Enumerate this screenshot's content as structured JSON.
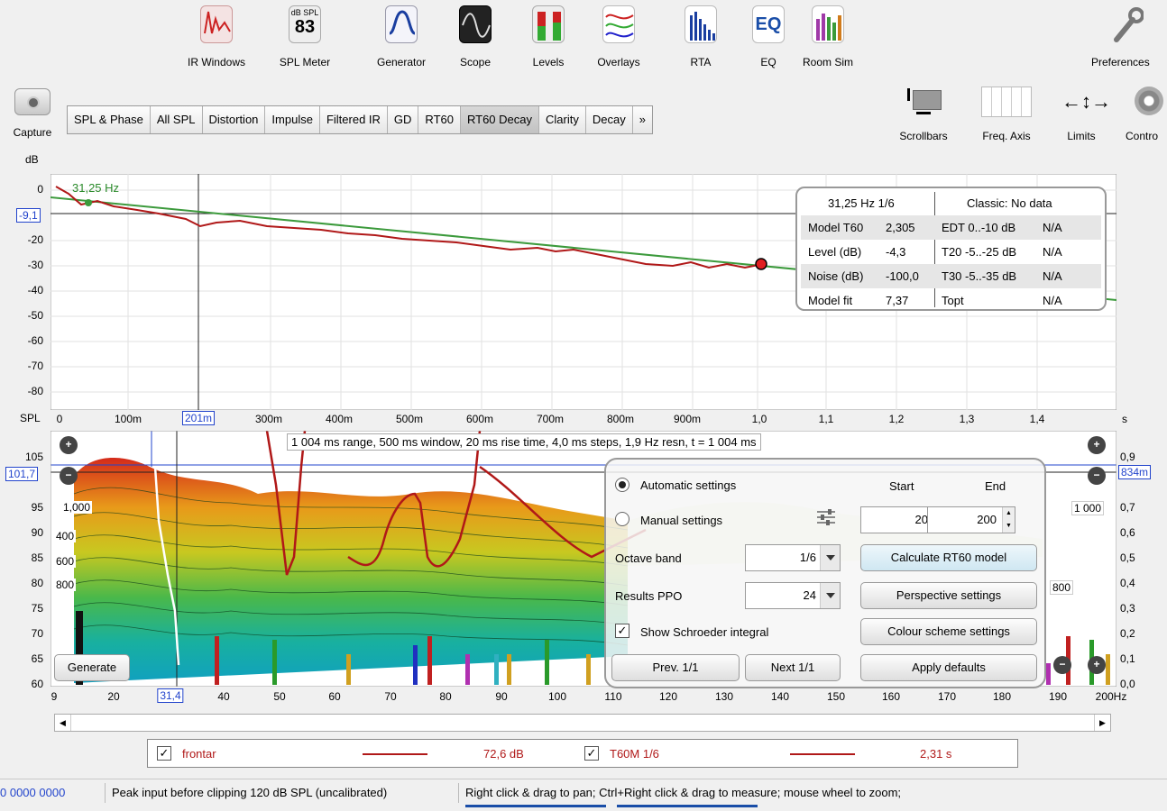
{
  "toolbar": {
    "items": [
      {
        "label": "IR Windows",
        "icon": "ir-windows-icon"
      },
      {
        "label": "SPL Meter",
        "icon": "spl-meter-icon",
        "meter_top": "dB SPL",
        "meter_value": "83"
      },
      {
        "label": "Generator",
        "icon": "generator-icon"
      },
      {
        "label": "Scope",
        "icon": "scope-icon"
      },
      {
        "label": "Levels",
        "icon": "levels-icon"
      },
      {
        "label": "Overlays",
        "icon": "overlays-icon"
      },
      {
        "label": "RTA",
        "icon": "rta-icon"
      },
      {
        "label": "EQ",
        "icon": "eq-icon"
      },
      {
        "label": "Room Sim",
        "icon": "room-sim-icon"
      }
    ],
    "preferences": "Preferences"
  },
  "capture": "Capture",
  "tabs": [
    "SPL & Phase",
    "All SPL",
    "Distortion",
    "Impulse",
    "Filtered IR",
    "GD",
    "RT60",
    "RT60 Decay",
    "Clarity",
    "Decay",
    "»"
  ],
  "active_tab": "RT60 Decay",
  "right_tools": [
    "Scrollbars",
    "Freq. Axis",
    "Limits",
    "Contro"
  ],
  "top_graph": {
    "unit": "dB",
    "y_ticks": [
      "0",
      "-20",
      "-30",
      "-40",
      "-50",
      "-60",
      "-70",
      "-80"
    ],
    "cursor_value": "-9,1",
    "marker_label": "31,25 Hz",
    "x_unit": "s",
    "x_ticks": [
      "0",
      "100m",
      "300m",
      "400m",
      "500m",
      "600m",
      "700m",
      "800m",
      "900m",
      "1,0",
      "1,1",
      "1,2",
      "1,3",
      "1,4"
    ],
    "x_cursor": "201m",
    "info": {
      "title_left": "31,25 Hz 1/6",
      "title_right": "Classic: No data",
      "rows": [
        {
          "k": "Model T60",
          "v": "2,305",
          "k2": "EDT  0..-10 dB",
          "v2": "N/A"
        },
        {
          "k": "Level (dB)",
          "v": "-4,3",
          "k2": "T20 -5..-25 dB",
          "v2": "N/A"
        },
        {
          "k": "Noise (dB)",
          "v": "-100,0",
          "k2": "T30 -5..-35 dB",
          "v2": "N/A"
        },
        {
          "k": "Model fit",
          "v": "7,37",
          "k2": "Topt",
          "v2": "N/A"
        }
      ]
    }
  },
  "bottom_graph": {
    "unit": "SPL",
    "y_ticks": [
      "105",
      "95",
      "90",
      "85",
      "80",
      "75",
      "70",
      "65",
      "60"
    ],
    "cursor_value": "101,7",
    "right_cursor": "834m",
    "right_ticks": [
      "0,9",
      "0,7",
      "0,6",
      "0,5",
      "0,4",
      "0,3",
      "0,2",
      "0,1",
      "0,0"
    ],
    "depth_labels": [
      "1,000",
      "400",
      "600",
      "800"
    ],
    "right_depth_labels": [
      "1 000",
      "800"
    ],
    "info_line": "1 004 ms range, 500 ms window, 20 ms rise time, 4,0 ms steps,  1,9 Hz resn, t = 1 004 ms",
    "x_ticks": [
      "9",
      "20",
      "40",
      "50",
      "60",
      "70",
      "80",
      "90",
      "100",
      "110",
      "120",
      "130",
      "140",
      "150",
      "160",
      "170",
      "180",
      "190",
      "200Hz"
    ],
    "x_cursor": "31,4",
    "generate": "Generate"
  },
  "panel": {
    "auto": "Automatic settings",
    "manual": "Manual settings",
    "start_label": "Start",
    "end_label": "End",
    "start_value": "20",
    "end_value": "200",
    "octave_label": "Octave band",
    "octave_value": "1/6",
    "ppo_label": "Results PPO",
    "ppo_value": "24",
    "schroeder": "Show Schroeder integral",
    "calc": "Calculate RT60 model",
    "perspective": "Perspective settings",
    "colour": "Colour scheme settings",
    "prev": "Prev. 1/1",
    "next": "Next 1/1",
    "apply": "Apply defaults"
  },
  "legend": [
    {
      "name": "frontar",
      "value": "72,6 dB",
      "color": "#b01818"
    },
    {
      "name": "T60M 1/6",
      "value": "2,31 s",
      "color": "#b01818"
    }
  ],
  "status": {
    "counter": "0  0000 0000",
    "peak": "Peak input before clipping 120 dB SPL (uncalibrated)",
    "hint": "Right click & drag to pan; Ctrl+Right click & drag to measure; mouse wheel to zoom;"
  }
}
